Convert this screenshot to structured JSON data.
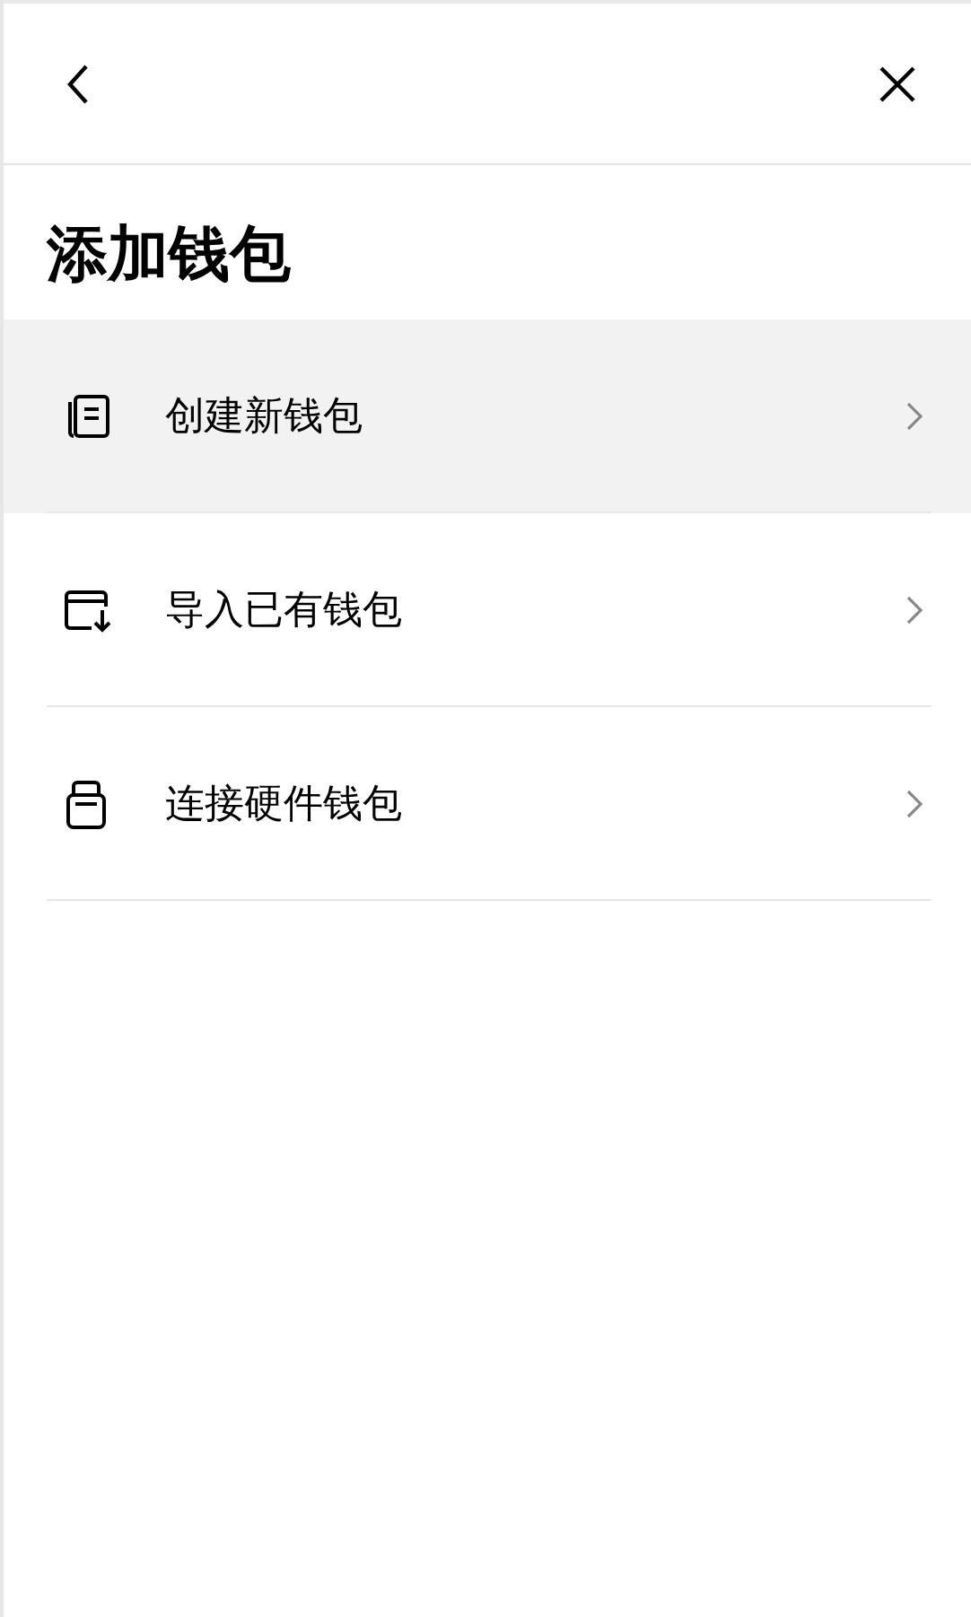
{
  "title": "添加钱包",
  "options": [
    {
      "kind": "create",
      "label": "创建新钱包",
      "selected": true
    },
    {
      "kind": "import",
      "label": "导入已有钱包",
      "selected": false
    },
    {
      "kind": "hardware",
      "label": "连接硬件钱包",
      "selected": false
    }
  ]
}
